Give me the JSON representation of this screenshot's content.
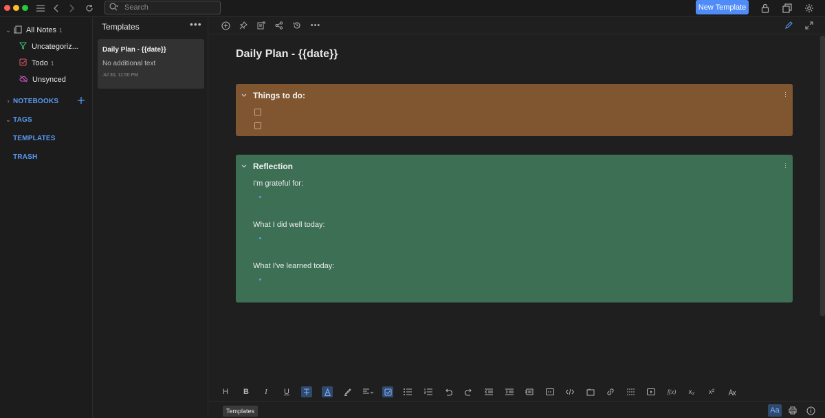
{
  "topbar": {
    "search_placeholder": "Search",
    "new_template_label": "New Template"
  },
  "sidebar": {
    "all_notes": {
      "label": "All Notes",
      "count": "1"
    },
    "uncategorized": {
      "label": "Uncategoriz..."
    },
    "todo": {
      "label": "Todo",
      "count": "1"
    },
    "unsynced": {
      "label": "Unsynced"
    },
    "notebooks": "NOTEBOOKS",
    "tags": "TAGS",
    "templates": "TEMPLATES",
    "trash": "TRASH"
  },
  "notelist": {
    "title": "Templates",
    "menu_label": "•••",
    "note": {
      "title": "Daily Plan - {{date}}",
      "preview": "No additional text",
      "date": "Jul 30, 11:50 PM"
    }
  },
  "editor": {
    "title": "Daily Plan - {{date}}",
    "blocks": {
      "todo": {
        "title": "Things to do:",
        "checkboxes": 2
      },
      "reflection": {
        "title": "Reflection",
        "prompts": [
          "I'm grateful for:",
          "What I did well today:",
          "What I've learned today:"
        ]
      }
    }
  },
  "format_toolbar": {
    "heading": "H",
    "bold": "B",
    "italic": "I",
    "underline": "U",
    "superscript": "x²",
    "subscript": "x₂",
    "math": "f(x)"
  },
  "status": {
    "chip_label": "Templates",
    "font_toggle": "Aa",
    "info": "i"
  },
  "colors": {
    "accent": "#4f8cf7",
    "todo_block": "#7f5630",
    "reflection_block": "#3c6f54"
  }
}
